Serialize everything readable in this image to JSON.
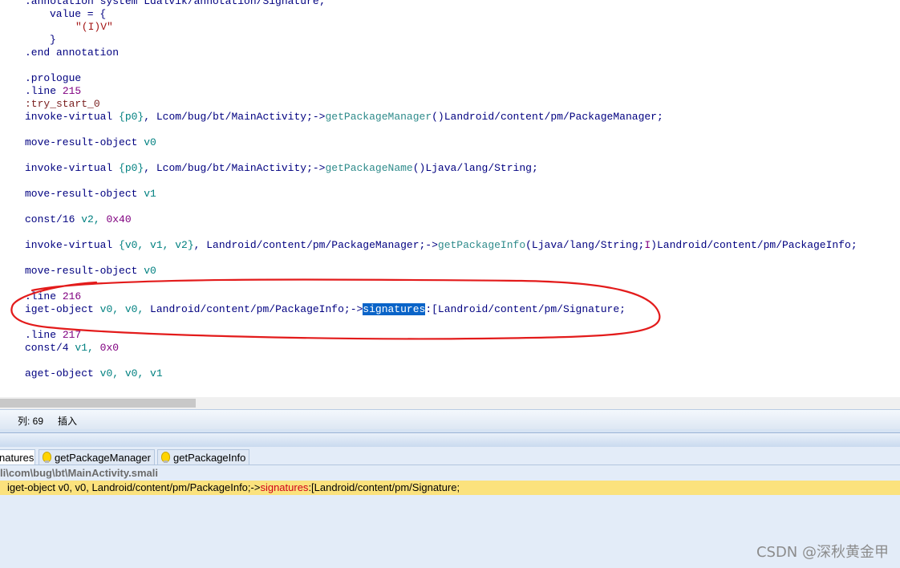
{
  "editor": {
    "lines": {
      "l0a": ".annotation system Ldalvik/annotation/Signature;",
      "l1_kw": "value = {",
      "l2_str": "\"(I)V\"",
      "l3": "}",
      "l4": ".end annotation",
      "l6": ".prologue",
      "l7_kw": ".line",
      "l7_num": "215",
      "l8": ":try_start_0",
      "l9_kw": "invoke-virtual",
      "l9_reg": "{p0}",
      "l9_a": ", Lcom/bug/bt/MainActivity;->",
      "l9_m": "getPackageManager",
      "l9_b": "()Landroid/content/pm/PackageManager;",
      "l11_kw": "move-result-object",
      "l11_reg": "v0",
      "l13_kw": "invoke-virtual",
      "l13_reg": "{p0}",
      "l13_a": ", Lcom/bug/bt/MainActivity;->",
      "l13_m": "getPackageName",
      "l13_b": "()Ljava/lang/String;",
      "l15_kw": "move-result-object",
      "l15_reg": "v1",
      "l17_kw": "const/16",
      "l17_reg": "v2,",
      "l17_num": "0x40",
      "l19_kw": "invoke-virtual",
      "l19_r1": "{v0, v1, v2}",
      "l19_a": ", Landroid/content/pm/PackageManager;->",
      "l19_m": "getPackageInfo",
      "l19_b": "(Ljava/lang/String;",
      "l19_i": "I",
      "l19_c": ")Landroid/content/pm/PackageInfo;",
      "l21_kw": "move-result-object",
      "l21_reg": "v0",
      "l23_kw": ".line",
      "l23_num": "216",
      "l24_kw": "iget-object",
      "l24_reg": "v0, v0,",
      "l24_a": " Landroid/content/pm/PackageInfo;->",
      "l24_sel": "signatures",
      "l24_b": ":[Landroid/content/pm/Signature;",
      "l26_kw": ".line",
      "l26_num": "217",
      "l27_kw": "const/4",
      "l27_reg": "v1,",
      "l27_num": "0x0",
      "l29_kw": "aget-object",
      "l29_reg": "v0, v0, v1"
    }
  },
  "status": {
    "column": "列: 69",
    "mode": "插入"
  },
  "results": {
    "tabs": [
      "natures",
      "getPackageManager",
      "getPackageInfo"
    ],
    "file_path": "li\\com\\bug\\bt\\MainActivity.smali",
    "match": {
      "pre": "iget-object v0, v0, Landroid/content/pm/PackageInfo;->",
      "hit": "signatures",
      "post": ":[Landroid/content/pm/Signature;"
    }
  },
  "watermark": "CSDN @深秋黄金甲",
  "colors": {
    "keyword": "#000080",
    "register": "#008080",
    "number": "#800080",
    "selection": "#0a64c8",
    "annotation_circle": "#e31b1b",
    "match_highlight": "#fbe27d"
  }
}
